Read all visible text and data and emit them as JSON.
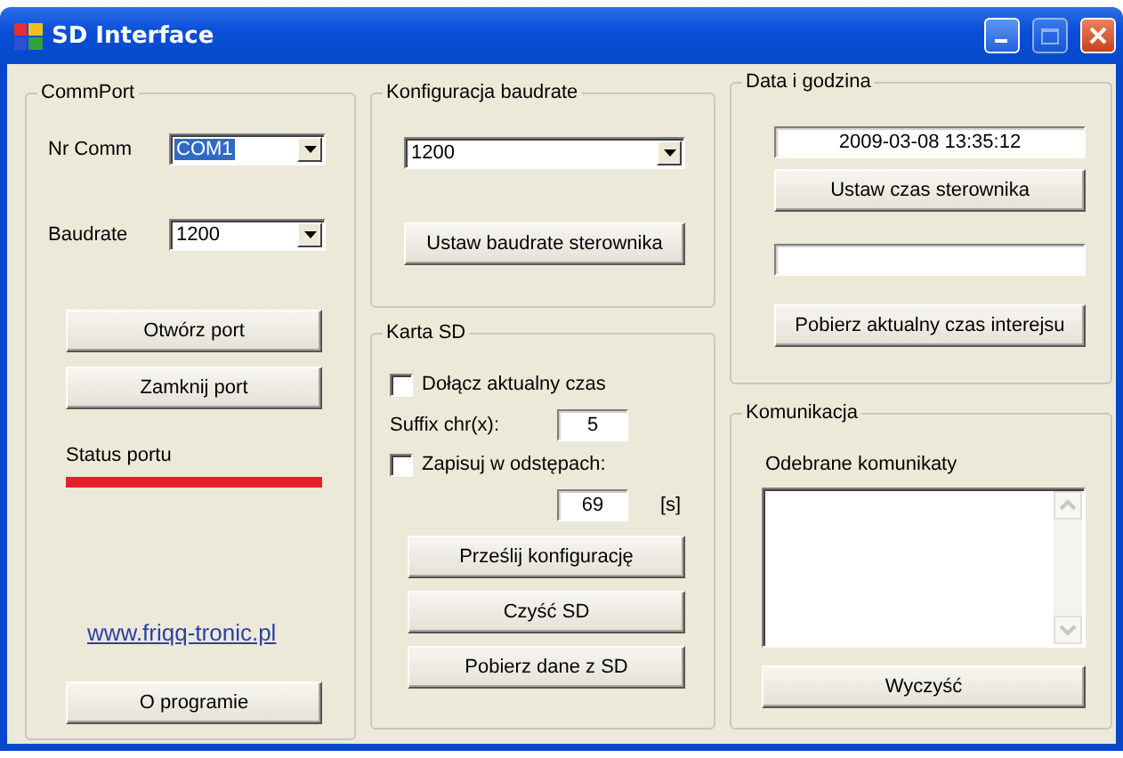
{
  "window": {
    "title": "SD Interface"
  },
  "commport": {
    "title": "CommPort",
    "nr_comm": {
      "label": "Nr Comm",
      "value": "COM1",
      "highlighted": true
    },
    "baudrate": {
      "label": "Baudrate",
      "value": "1200",
      "highlighted": false
    },
    "buttons": [
      "Otwórz port",
      "Zamknij port"
    ],
    "status": {
      "label": "Status portu",
      "connected": false
    },
    "link": "www.friqq-tronic.pl",
    "about_button": "O programie"
  },
  "baud_config": {
    "title": "Konfiguracja baudrate",
    "value": "1200",
    "button": "Ustaw baudrate sterownika"
  },
  "sd_card": {
    "title": "Karta SD",
    "append_time": {
      "label": "Dołącz aktualny czas",
      "checked": false
    },
    "suffix": {
      "label": "Suffix chr(x):",
      "value": "5"
    },
    "interval": {
      "label": "Zapisuj w odstępach:",
      "checked": false
    },
    "interval_value": {
      "value": "69",
      "unit": "[s]"
    },
    "buttons": [
      "Prześlij konfigurację",
      "Czyść SD",
      "Pobierz dane z SD"
    ]
  },
  "datetime": {
    "title": "Data i godzina",
    "value": "2009-03-08 13:35:12",
    "set_button": "Ustaw czas sterownika",
    "get_button": "Pobierz aktualny czas interejsu"
  },
  "communication": {
    "title": "Komunikacja",
    "label": "Odebrane komunikaty",
    "clear_button": "Wyczyść"
  }
}
